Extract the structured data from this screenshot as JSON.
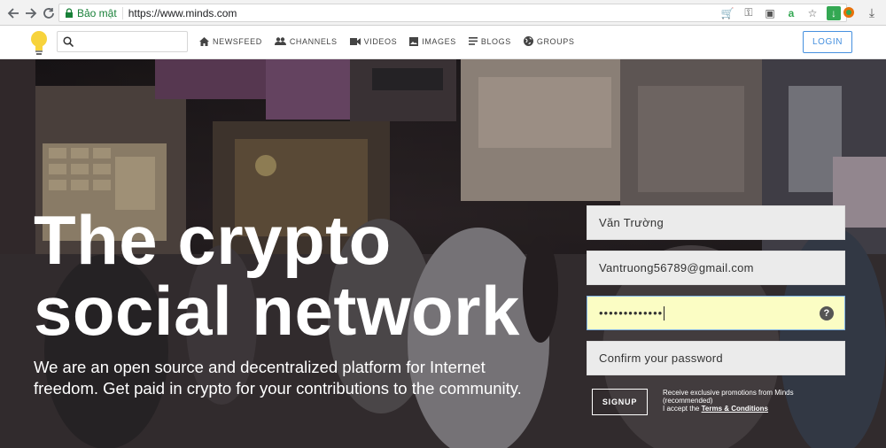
{
  "browser": {
    "secure_label": "Bảo mật",
    "url": "https://www.minds.com"
  },
  "header": {
    "search_placeholder": "",
    "nav": [
      {
        "label": "NEWSFEED",
        "icon": "home-icon"
      },
      {
        "label": "CHANNELS",
        "icon": "people-icon"
      },
      {
        "label": "VIDEOS",
        "icon": "video-camera-icon"
      },
      {
        "label": "IMAGES",
        "icon": "image-icon"
      },
      {
        "label": "BLOGS",
        "icon": "list-icon"
      },
      {
        "label": "GROUPS",
        "icon": "globe-icon"
      }
    ],
    "login_label": "LOGIN"
  },
  "hero": {
    "headline_line1": "The crypto",
    "headline_line2": "social network",
    "subline": "We are an open source and decentralized platform for Internet freedom. Get paid in crypto for your contributions to the community."
  },
  "signup": {
    "username_value": "Văn Trường",
    "email_value": "Vantruong56789@gmail.com",
    "password_dots": "•••••••••••••",
    "confirm_placeholder": "Confirm your password",
    "signup_label": "SIGNUP",
    "promo_line1": "Receive exclusive promotions from Minds (recommended)",
    "promo_line2_prefix": "I accept the ",
    "terms_label": "Terms & Conditions"
  },
  "colors": {
    "accent_blue": "#4690df",
    "secure_green": "#188038",
    "autofill_yellow": "#fbfdc4"
  }
}
